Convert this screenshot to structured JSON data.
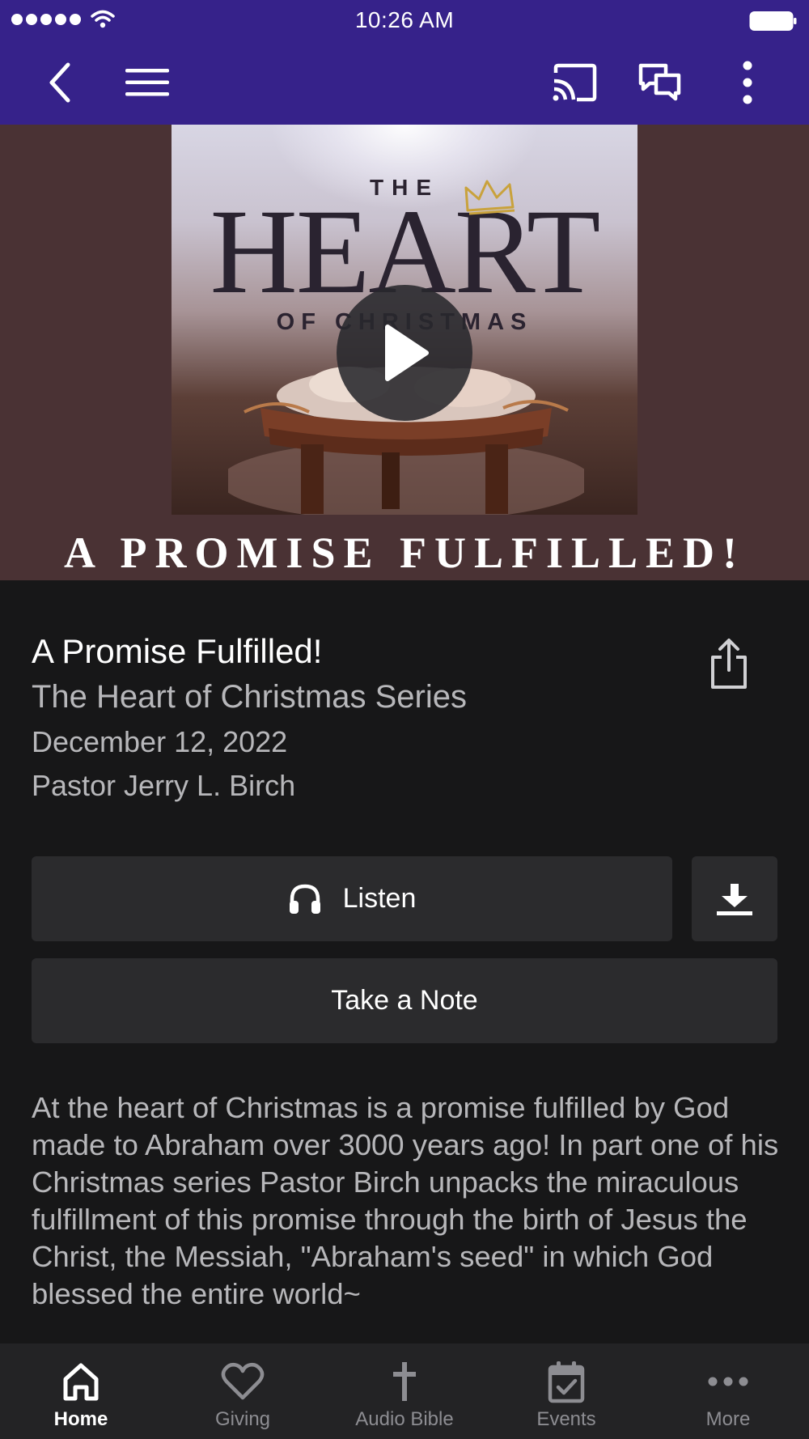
{
  "status_bar": {
    "time": "10:26 AM",
    "signal_icon": "signal-dots-icon",
    "wifi_icon": "wifi-icon",
    "battery_icon": "battery-icon"
  },
  "nav": {
    "back_icon": "chevron-left-icon",
    "menu_icon": "hamburger-menu-icon",
    "cast_icon": "cast-icon",
    "chat_icon": "chat-bubbles-icon",
    "more_icon": "vertical-dots-icon",
    "background": "#36228a"
  },
  "hero": {
    "art_the": "THE",
    "art_heart": "HEART",
    "art_of_christmas": "OF CHRISTMAS",
    "caption": "A PROMISE FULFILLED!",
    "play_icon": "play-icon"
  },
  "sermon": {
    "title": "A Promise Fulfilled!",
    "series": "The Heart of Christmas Series",
    "date": "December 12, 2022",
    "speaker": "Pastor Jerry L. Birch",
    "share_icon": "share-icon"
  },
  "actions": {
    "listen_label": "Listen",
    "listen_icon": "headphones-icon",
    "download_icon": "download-icon",
    "note_label": "Take a Note"
  },
  "description": "At the heart of Christmas is a promise fulfilled by God made to Abraham over 3000 years ago! In part one of his Christmas series Pastor Birch unpacks the miraculous fulfillment of this promise through the birth of Jesus the Christ, the Messiah, \"Abraham's seed\" in which God  blessed the entire world~",
  "tabs": [
    {
      "label": "Home",
      "icon": "home-icon",
      "active": true
    },
    {
      "label": "Giving",
      "icon": "heart-icon",
      "active": false
    },
    {
      "label": "Audio Bible",
      "icon": "cross-icon",
      "active": false
    },
    {
      "label": "Events",
      "icon": "calendar-check-icon",
      "active": false
    },
    {
      "label": "More",
      "icon": "horizontal-dots-icon",
      "active": false
    }
  ]
}
